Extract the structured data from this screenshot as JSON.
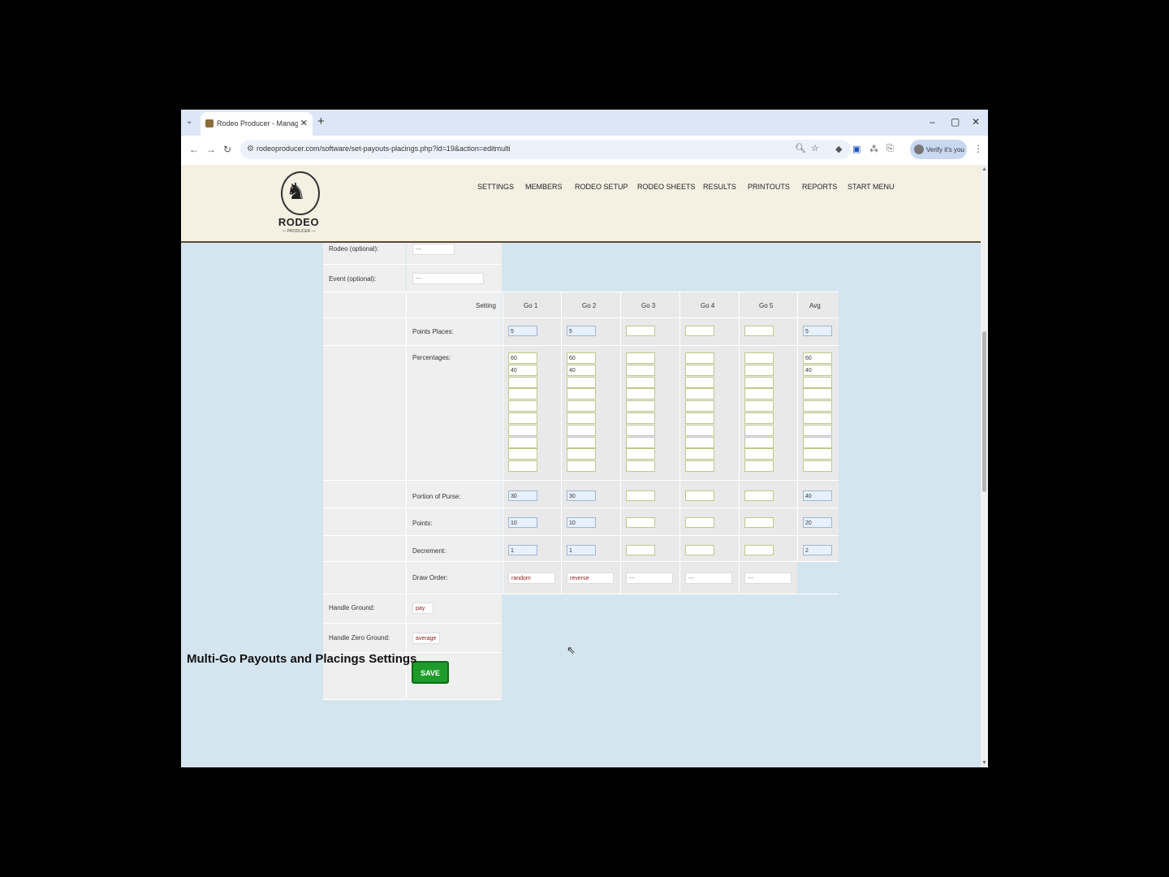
{
  "browser": {
    "tab_title": "Rodeo Producer - Manage Pay",
    "url": "rodeoproducer.com/software/set-payouts-placings.php?id=19&action=editmulti",
    "profile_label": "Verify it's you"
  },
  "site": {
    "logo_text": "RODEO",
    "logo_sub": "— PRODUCER —",
    "menu": [
      "SETTINGS",
      "MEMBERS",
      "RODEO SETUP",
      "RODEO SHEETS",
      "RESULTS",
      "PRINTOUTS",
      "REPORTS",
      "START MENU"
    ]
  },
  "form": {
    "rodeo_label": "Rodeo (optional):",
    "rodeo_value": "---",
    "event_label": "Event (optional):",
    "event_value": "---",
    "setting_header": "Setting",
    "columns": [
      "Go 1",
      "Go 2",
      "Go 3",
      "Go 4",
      "Go 5",
      "Avg"
    ],
    "points_places_label": "Points Places:",
    "points_places": [
      "5",
      "5",
      "",
      "",
      "",
      "5"
    ],
    "percentages_label": "Percentages:",
    "percentages": [
      [
        "60",
        "40",
        "",
        "",
        "",
        "",
        "",
        "",
        "",
        ""
      ],
      [
        "60",
        "40",
        "",
        "",
        "",
        "",
        "",
        "",
        "",
        ""
      ],
      [
        "",
        "",
        "",
        "",
        "",
        "",
        "",
        "",
        "",
        ""
      ],
      [
        "",
        "",
        "",
        "",
        "",
        "",
        "",
        "",
        "",
        ""
      ],
      [
        "",
        "",
        "",
        "",
        "",
        "",
        "",
        "",
        "",
        ""
      ],
      [
        "60",
        "40",
        "",
        "",
        "",
        "",
        "",
        "",
        "",
        ""
      ]
    ],
    "portion_label": "Portion of Purse:",
    "portion": [
      "30",
      "30",
      "",
      "",
      "",
      "40"
    ],
    "points_label": "Points:",
    "points": [
      "10",
      "10",
      "",
      "",
      "",
      "20"
    ],
    "decrement_label": "Decrement:",
    "decrement": [
      "1",
      "1",
      "",
      "",
      "",
      "2"
    ],
    "draw_order_label": "Draw Order:",
    "draw_order": [
      "random",
      "reverse",
      "---",
      "---",
      "---"
    ],
    "handle_ground_label": "Handle Ground:",
    "handle_ground": "pay",
    "handle_zero_label": "Handle Zero Ground:",
    "handle_zero": "average",
    "save_label": "SAVE"
  },
  "section_title": "Multi-Go Payouts and Placings Settings"
}
